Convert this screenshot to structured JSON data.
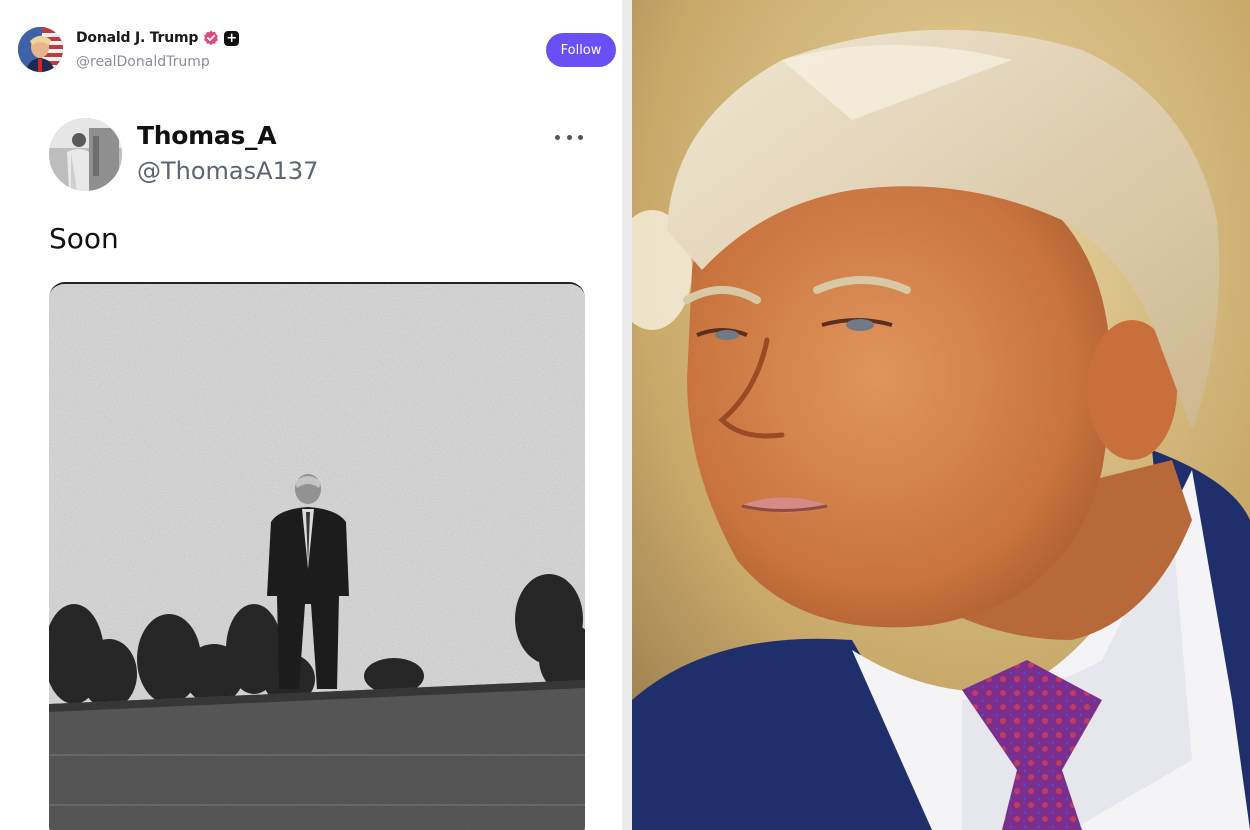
{
  "poster": {
    "name": "Donald J. Trump",
    "handle": "@realDonaldTrump",
    "follow_label": "Follow",
    "verified_color": "#e0487f",
    "plus_glyph": "+"
  },
  "tweet": {
    "author": "Thomas_A",
    "handle": "@ThomasA137",
    "text": "Soon",
    "more_icon": "more-horizontal-icon"
  },
  "colors": {
    "follow_button": "#6a4ff5",
    "handle_gray": "#5b6570"
  }
}
